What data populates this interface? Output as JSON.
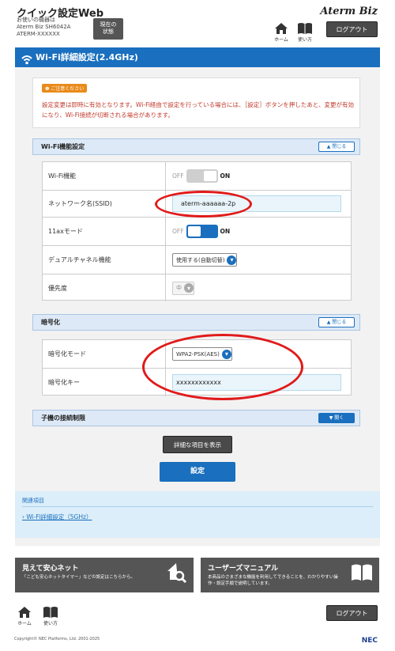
{
  "header": {
    "app_title": "クイック設定Web",
    "device_label": "お使いの機器は",
    "device_model": "Aterm Biz SH6042A",
    "device_id": "ATERM-XXXXXX",
    "status_button": "現在の\n状態",
    "brand": "Aterm Biz",
    "home_label": "ホーム",
    "manual_label": "使い方",
    "logout_label": "ログアウト"
  },
  "page": {
    "title": "Wi-Fi詳細設定(2.4GHz)"
  },
  "notice": {
    "tag": "ご注意ください",
    "text": "設定変更は即時に有効となります。Wi-Fi経由で設定を行っている場合には、［設定］ボタンを押したあと、変更が有効になり、Wi-Fi接続が切断される場合があります。"
  },
  "wifi_section": {
    "title": "Wi-Fi機能設定",
    "toggle_label": "閉じる",
    "rows": [
      {
        "label": "Wi-Fi機能",
        "off": "OFF",
        "on": "ON"
      },
      {
        "label": "ネットワーク名(SSID)",
        "value": "aterm-aaaaaa-2p"
      },
      {
        "label": "11axモード",
        "off": "OFF",
        "on": "ON"
      },
      {
        "label": "デュアルチャネル機能",
        "value": "使用する(自動切替)"
      },
      {
        "label": "優先度",
        "value": "中"
      }
    ]
  },
  "encryption_section": {
    "title": "暗号化",
    "toggle_label": "閉じる",
    "rows": [
      {
        "label": "暗号化モード",
        "value": "WPA2-PSK(AES)"
      },
      {
        "label": "暗号化キー",
        "value": "xxxxxxxxxxxx"
      }
    ]
  },
  "client_section": {
    "title": "子機の接続制限",
    "toggle_label": "開く"
  },
  "actions": {
    "show_details": "詳細な項目を表示",
    "apply": "設定"
  },
  "related": {
    "title": "関連項目",
    "link": "Wi-Fi詳細設定（5GHz）"
  },
  "cards": [
    {
      "title": "見えて安心ネット",
      "desc": "「こども安心ネットタイマー」などの設定はこちらから。"
    },
    {
      "title": "ユーザーズマニュアル",
      "desc": "本商品のさまざまな機能を利用してできることを、わかりやすい操作・設定手順で説明しています。"
    }
  ],
  "footer": {
    "home_label": "ホーム",
    "manual_label": "使い方",
    "logout_label": "ログアウト",
    "copyright": "Copyright© NEC Platforms, Ltd. 2001-2025",
    "vendor": "NEC"
  },
  "colors": {
    "primary": "#1a6fbe",
    "warning": "#e98a1a",
    "annotation": "#e11a1a"
  }
}
